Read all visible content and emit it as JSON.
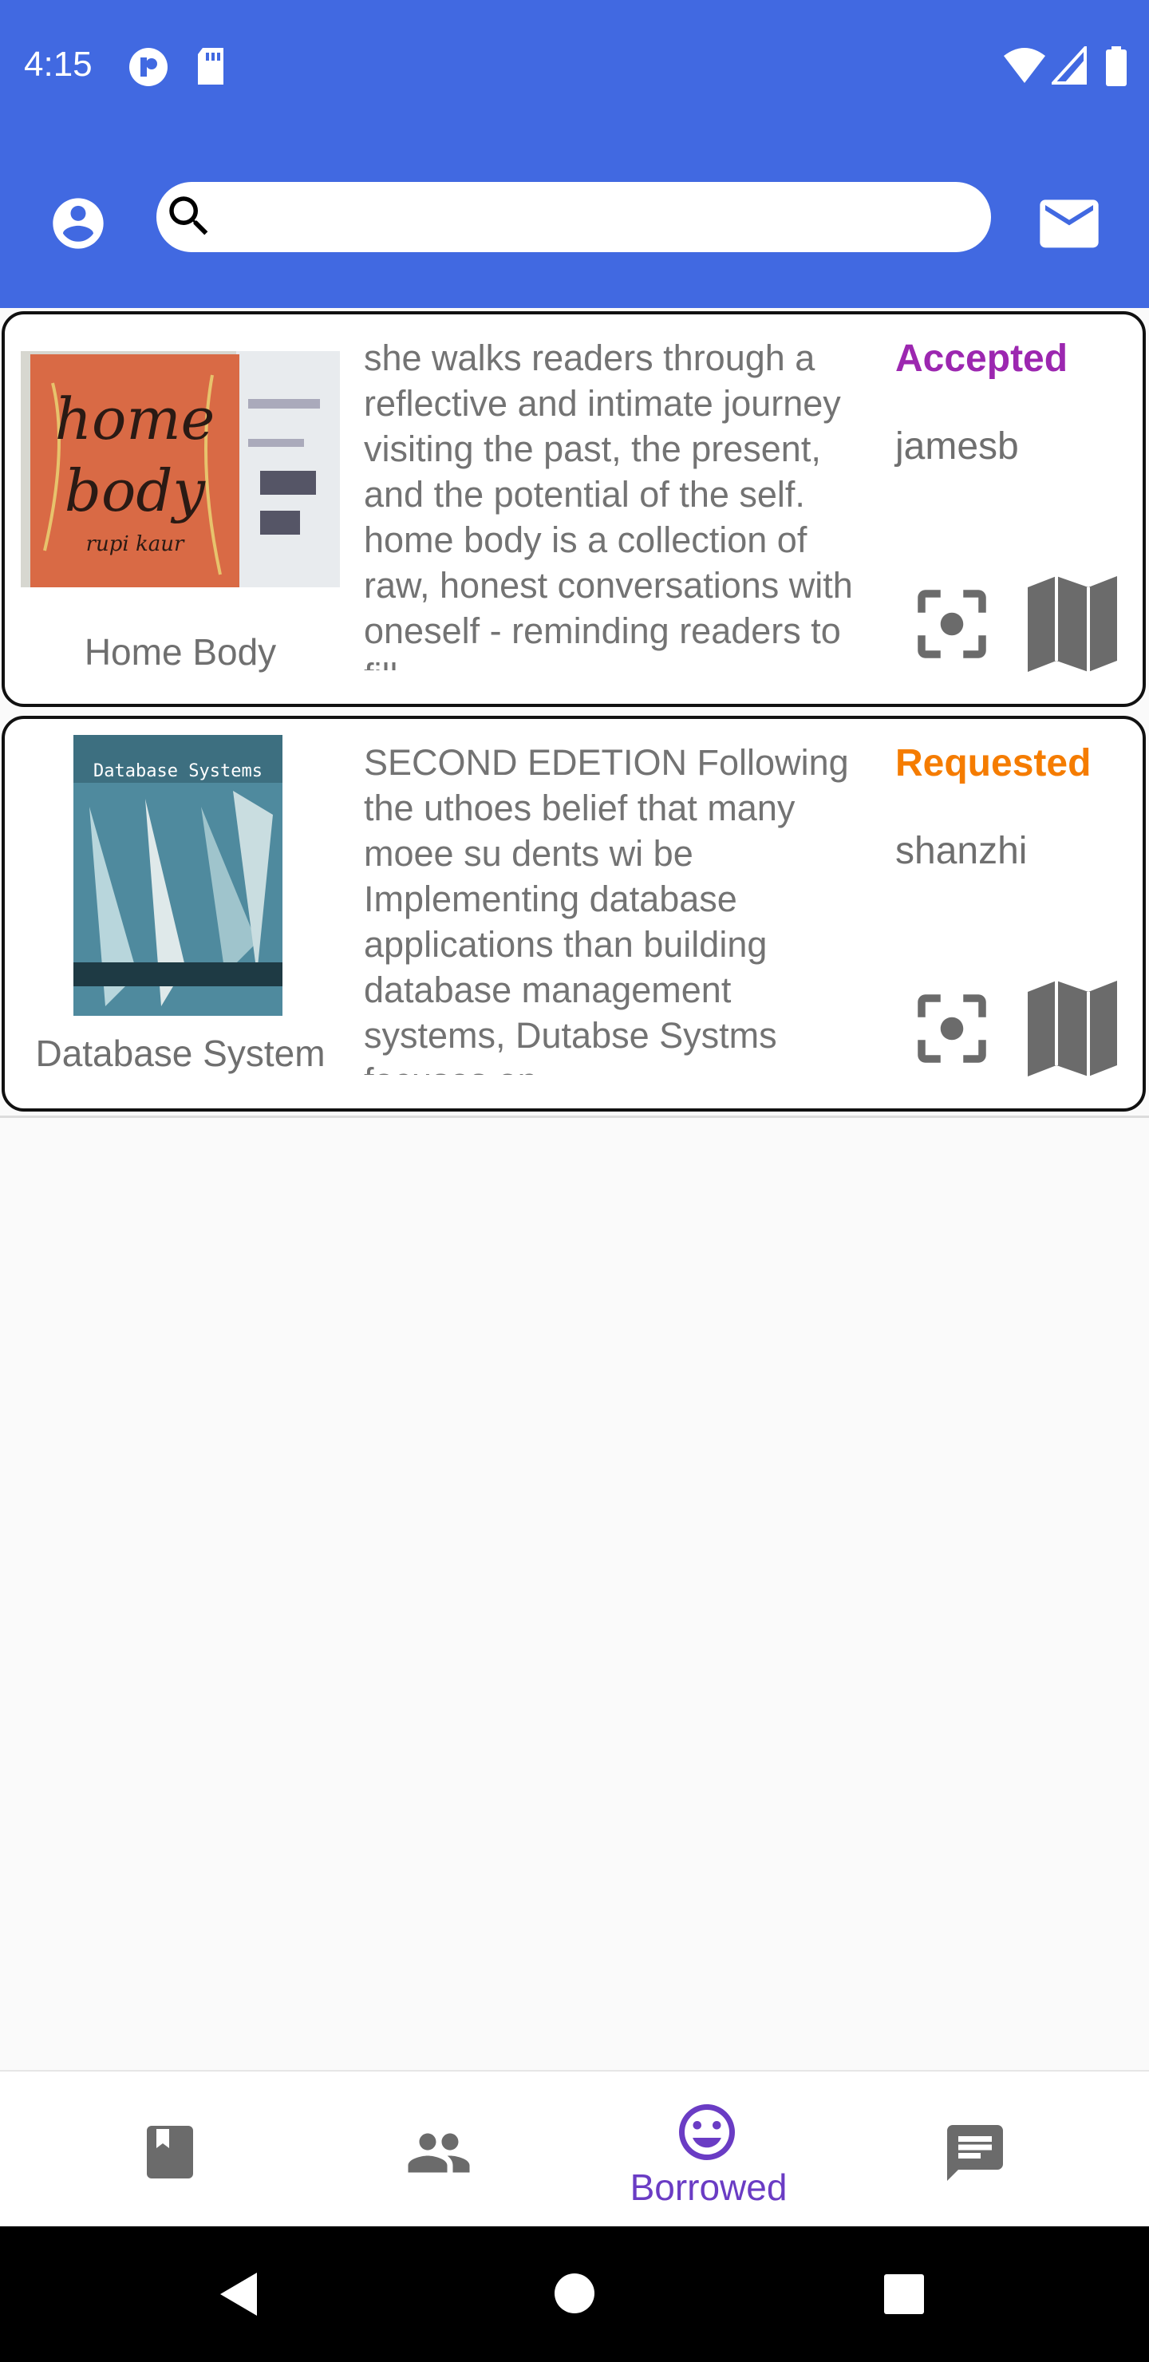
{
  "status_bar": {
    "time": "4:15"
  },
  "search": {
    "placeholder": "",
    "value": ""
  },
  "books": [
    {
      "title": "Home Body",
      "description": "she walks readers through a reflective and intimate journey visiting the past, the present, and the potential of the self. home body is a collection of raw, honest conversations with oneself - reminding readers to fill",
      "status": "Accepted",
      "status_color": "#9c27b0",
      "owner": "jamesb",
      "cover_text": [
        "home",
        "body",
        "rupi kaur"
      ]
    },
    {
      "title": "Database System",
      "description": "SECOND EDETION Following the uthoes belief that many moee su dents wi be Implementing database applications than building database management systems, Dutabse Systms focuses on",
      "status": "Requested",
      "status_color": "#f57c00",
      "owner": "shanzhi",
      "cover_text": [
        "Database Systems"
      ]
    }
  ],
  "bottom_nav": {
    "items": [
      {
        "icon": "book-icon",
        "label": ""
      },
      {
        "icon": "people-icon",
        "label": ""
      },
      {
        "icon": "smiley-icon",
        "label": "Borrowed"
      },
      {
        "icon": "chat-icon",
        "label": ""
      }
    ],
    "active_color": "#6a3cc4"
  }
}
